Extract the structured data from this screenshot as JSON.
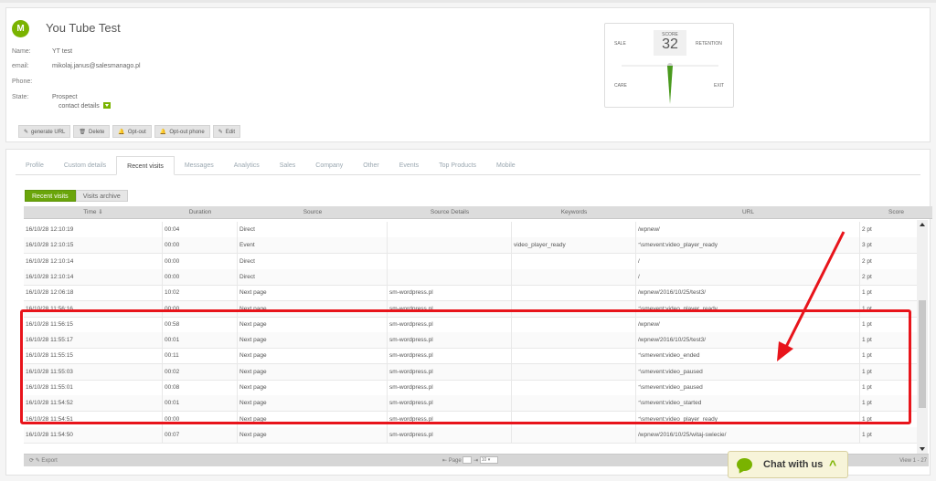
{
  "contact": {
    "avatar_letter": "M",
    "name": "You Tube Test",
    "fields": [
      {
        "key": "Name:",
        "value": "YT test"
      },
      {
        "key": "email:",
        "value": "mikolaj.janus@salesmanago.pl"
      },
      {
        "key": "Phone:",
        "value": ""
      },
      {
        "key": "State:",
        "value": "Prospect"
      }
    ],
    "contact_details": "contact details"
  },
  "actions": [
    {
      "icon": "✎",
      "label": "generate URL"
    },
    {
      "icon": "🗑",
      "label": "Delete"
    },
    {
      "icon": "🔔",
      "label": "Opt-out"
    },
    {
      "icon": "🔔",
      "label": "Opt-out phone"
    },
    {
      "icon": "✎",
      "label": "Edit"
    }
  ],
  "score": {
    "title": "SCORE",
    "value": "32",
    "sale": "SALE",
    "retention": "RETENTION",
    "care": "CARE",
    "exit": "EXIT"
  },
  "tabs": [
    {
      "label": "Profile",
      "active": false
    },
    {
      "label": "Custom details",
      "active": false
    },
    {
      "label": "Recent visits",
      "active": true
    },
    {
      "label": "Messages",
      "active": false
    },
    {
      "label": "Analytics",
      "active": false
    },
    {
      "label": "Sales",
      "active": false
    },
    {
      "label": "Company",
      "active": false
    },
    {
      "label": "Other",
      "active": false
    },
    {
      "label": "Events",
      "active": false
    },
    {
      "label": "Top Products",
      "active": false
    },
    {
      "label": "Mobile",
      "active": false
    }
  ],
  "subtabs": [
    {
      "label": "Recent visits",
      "active": true
    },
    {
      "label": "Visits archive",
      "active": false
    }
  ],
  "columns": [
    "Time ⇓",
    "Duration",
    "Source",
    "Source Details",
    "Keywords",
    "URL",
    "Score"
  ],
  "rows": [
    [
      "16/10/28 12:10:19",
      "00:04",
      "Direct",
      "",
      "",
      "/wpnew/",
      "2 pt"
    ],
    [
      "16/10/28 12:10:15",
      "00:00",
      "Event",
      "",
      "video_player_ready",
      "smevent:video_player_ready",
      "3 pt"
    ],
    [
      "16/10/28 12:10:14",
      "00:00",
      "Direct",
      "",
      "",
      "/",
      "2 pt"
    ],
    [
      "16/10/28 12:10:14",
      "00:00",
      "Direct",
      "",
      "",
      "/",
      "2 pt"
    ],
    [
      "16/10/28 12:06:18",
      "10:02",
      "Next page",
      "sm-wordpress.pl",
      "",
      "/wpnew/2016/10/25/test3/",
      "1 pt"
    ],
    [
      "16/10/28 11:56:16",
      "00:00",
      "Next page",
      "sm-wordpress.pl",
      "",
      "smevent:video_player_ready",
      "1 pt"
    ],
    [
      "16/10/28 11:56:15",
      "00:58",
      "Next page",
      "sm-wordpress.pl",
      "",
      "/wpnew/",
      "1 pt"
    ],
    [
      "16/10/28 11:55:17",
      "00:01",
      "Next page",
      "sm-wordpress.pl",
      "",
      "/wpnew/2016/10/25/test3/",
      "1 pt"
    ],
    [
      "16/10/28 11:55:15",
      "00:11",
      "Next page",
      "sm-wordpress.pl",
      "",
      "smevent:video_ended",
      "1 pt"
    ],
    [
      "16/10/28 11:55:03",
      "00:02",
      "Next page",
      "sm-wordpress.pl",
      "",
      "smevent:video_paused",
      "1 pt"
    ],
    [
      "16/10/28 11:55:01",
      "00:08",
      "Next page",
      "sm-wordpress.pl",
      "",
      "smevent:video_paused",
      "1 pt"
    ],
    [
      "16/10/28 11:54:52",
      "00:01",
      "Next page",
      "sm-wordpress.pl",
      "",
      "smevent:video_started",
      "1 pt"
    ],
    [
      "16/10/28 11:54:51",
      "00:00",
      "Next page",
      "sm-wordpress.pl",
      "",
      "smevent:video_player_ready",
      "1 pt"
    ],
    [
      "16/10/28 11:54:50",
      "00:07",
      "Next page",
      "sm-wordpress.pl",
      "",
      "/wpnew/2016/10/25/witaj-swiecie/",
      "1 pt"
    ]
  ],
  "rss_flags": [
    false,
    true,
    false,
    false,
    false,
    true,
    false,
    false,
    true,
    true,
    true,
    true,
    true,
    false
  ],
  "pager": {
    "export": "Export",
    "page_label": "Page",
    "page_value": "1",
    "per_page": "10",
    "view": "View 1 - 27"
  },
  "chat": {
    "label": "Chat with us"
  },
  "colors": {
    "accent": "#7ab300",
    "highlight": "#e8141b"
  }
}
